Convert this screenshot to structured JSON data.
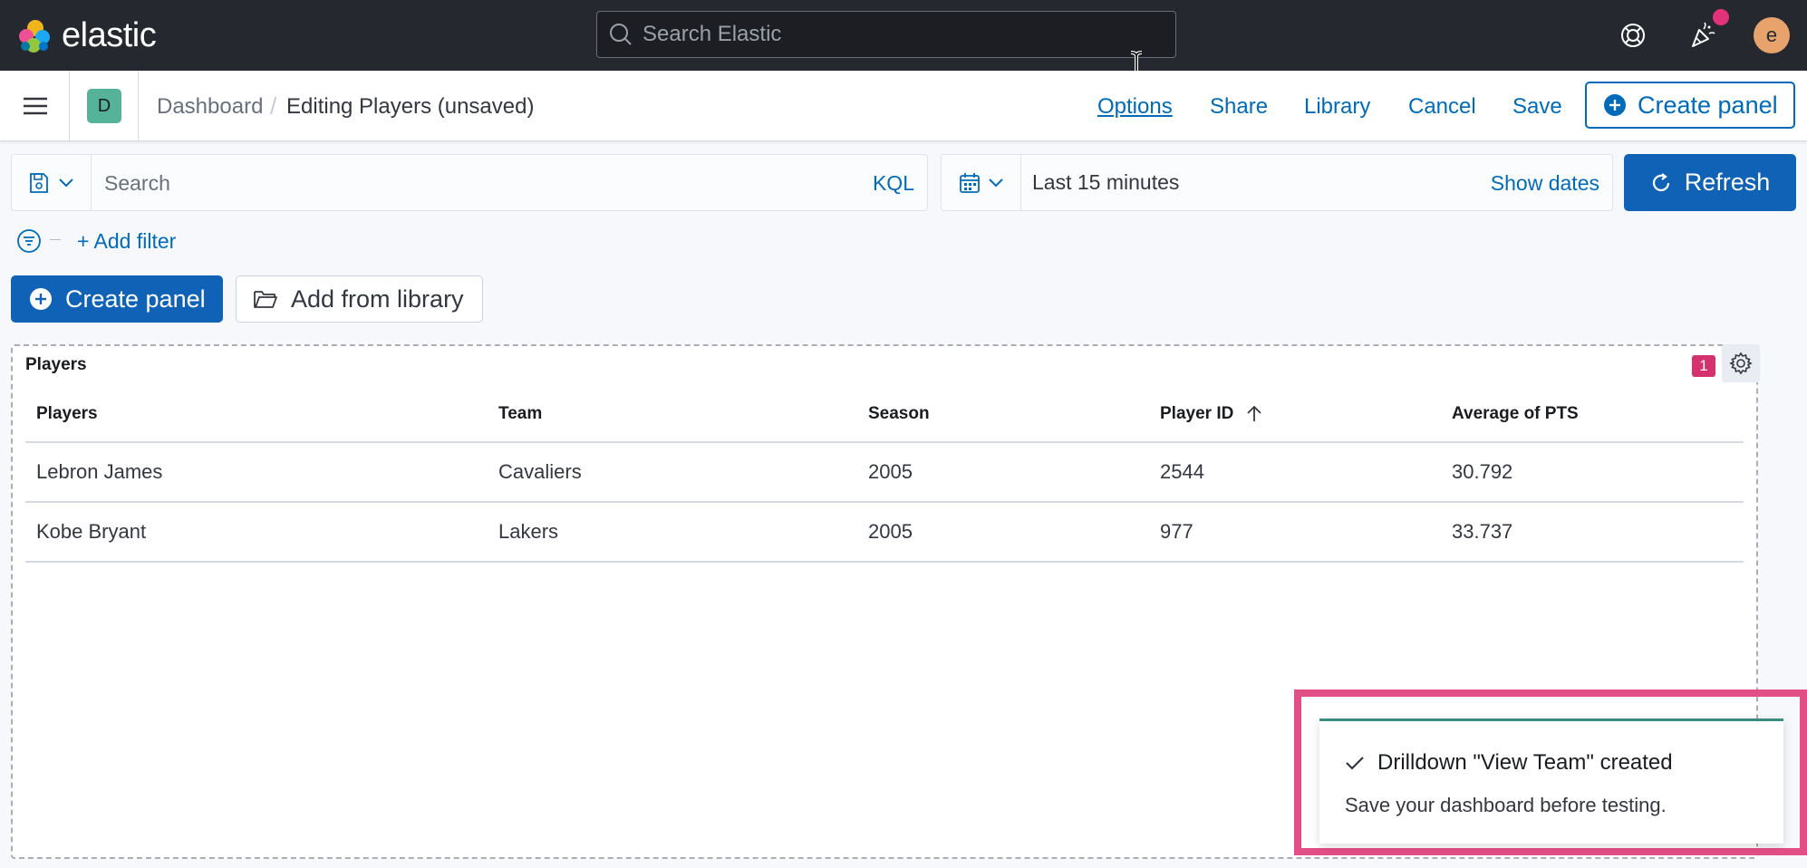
{
  "header": {
    "brand": "elastic",
    "search_placeholder": "Search Elastic",
    "user_initial": "e"
  },
  "nav": {
    "space_initial": "D",
    "breadcrumbs": [
      "Dashboard",
      "Editing Players (unsaved)"
    ],
    "breadcrumb_separator": "/",
    "links": {
      "options": "Options",
      "share": "Share",
      "library": "Library",
      "cancel": "Cancel",
      "save": "Save"
    },
    "create_panel": "Create panel"
  },
  "query": {
    "search_placeholder": "Search",
    "language": "KQL",
    "time_range": "Last 15 minutes",
    "show_dates": "Show dates",
    "refresh": "Refresh",
    "add_filter": "+ Add filter"
  },
  "actions": {
    "create_panel": "Create panel",
    "add_from_library": "Add from library"
  },
  "panel": {
    "title": "Players",
    "badge_count": "1",
    "columns": [
      "Players",
      "Team",
      "Season",
      "Player ID",
      "Average of PTS"
    ],
    "rows": [
      [
        "Lebron James",
        "Cavaliers",
        "2005",
        "2544",
        "30.792"
      ],
      [
        "Kobe Bryant",
        "Lakers",
        "2005",
        "977",
        "33.737"
      ]
    ]
  },
  "toast": {
    "title": "Drilldown \"View Team\" created",
    "body": "Save your dashboard before testing."
  },
  "colors": {
    "header_bg": "#25282f",
    "primary": "#0f62b5",
    "link": "#006bb8",
    "space_badge": "#54b399",
    "notification": "#e2337a",
    "avatar": "#e7a36b",
    "highlight": "#e24f86"
  }
}
